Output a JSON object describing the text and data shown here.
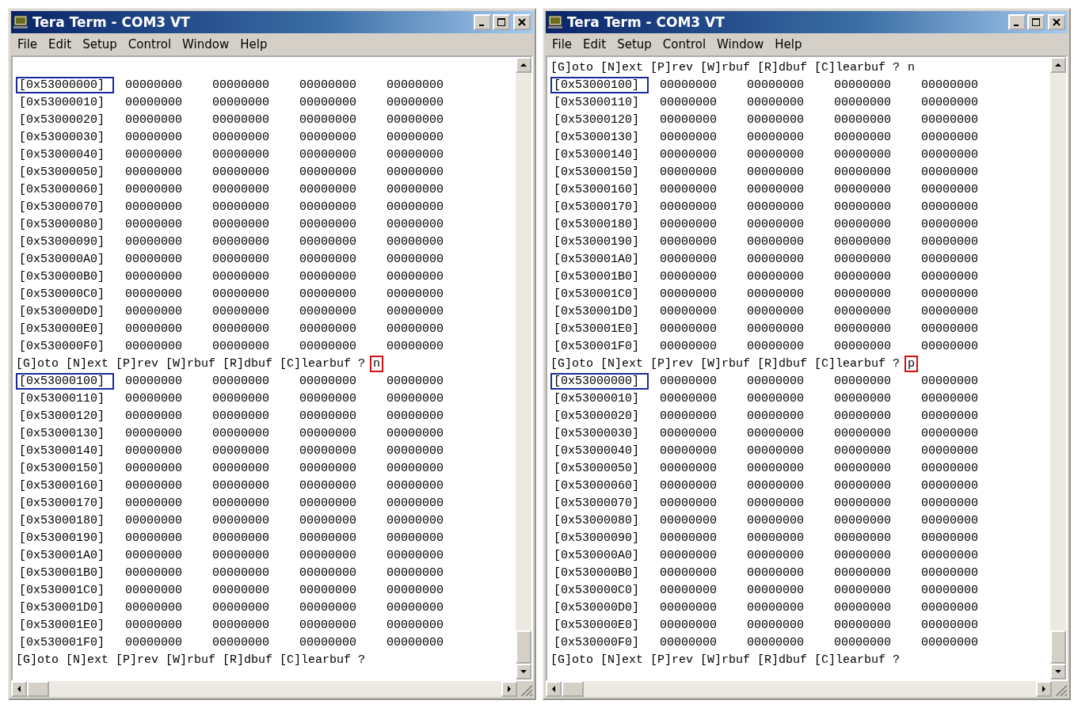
{
  "windows": [
    {
      "title": "Tera Term - COM3 VT",
      "menu": [
        "File",
        "Edit",
        "Setup",
        "Control",
        "Window",
        "Help"
      ],
      "lines": [
        {
          "kind": "blank"
        },
        {
          "kind": "row",
          "address": "[0x53000000]",
          "marked": true,
          "values": [
            "00000000",
            "00000000",
            "00000000",
            "00000000"
          ]
        },
        {
          "kind": "row",
          "address": "[0x53000010]",
          "marked": false,
          "values": [
            "00000000",
            "00000000",
            "00000000",
            "00000000"
          ]
        },
        {
          "kind": "row",
          "address": "[0x53000020]",
          "marked": false,
          "values": [
            "00000000",
            "00000000",
            "00000000",
            "00000000"
          ]
        },
        {
          "kind": "row",
          "address": "[0x53000030]",
          "marked": false,
          "values": [
            "00000000",
            "00000000",
            "00000000",
            "00000000"
          ]
        },
        {
          "kind": "row",
          "address": "[0x53000040]",
          "marked": false,
          "values": [
            "00000000",
            "00000000",
            "00000000",
            "00000000"
          ]
        },
        {
          "kind": "row",
          "address": "[0x53000050]",
          "marked": false,
          "values": [
            "00000000",
            "00000000",
            "00000000",
            "00000000"
          ]
        },
        {
          "kind": "row",
          "address": "[0x53000060]",
          "marked": false,
          "values": [
            "00000000",
            "00000000",
            "00000000",
            "00000000"
          ]
        },
        {
          "kind": "row",
          "address": "[0x53000070]",
          "marked": false,
          "values": [
            "00000000",
            "00000000",
            "00000000",
            "00000000"
          ]
        },
        {
          "kind": "row",
          "address": "[0x53000080]",
          "marked": false,
          "values": [
            "00000000",
            "00000000",
            "00000000",
            "00000000"
          ]
        },
        {
          "kind": "row",
          "address": "[0x53000090]",
          "marked": false,
          "values": [
            "00000000",
            "00000000",
            "00000000",
            "00000000"
          ]
        },
        {
          "kind": "row",
          "address": "[0x530000A0]",
          "marked": false,
          "values": [
            "00000000",
            "00000000",
            "00000000",
            "00000000"
          ]
        },
        {
          "kind": "row",
          "address": "[0x530000B0]",
          "marked": false,
          "values": [
            "00000000",
            "00000000",
            "00000000",
            "00000000"
          ]
        },
        {
          "kind": "row",
          "address": "[0x530000C0]",
          "marked": false,
          "values": [
            "00000000",
            "00000000",
            "00000000",
            "00000000"
          ]
        },
        {
          "kind": "row",
          "address": "[0x530000D0]",
          "marked": false,
          "values": [
            "00000000",
            "00000000",
            "00000000",
            "00000000"
          ]
        },
        {
          "kind": "row",
          "address": "[0x530000E0]",
          "marked": false,
          "values": [
            "00000000",
            "00000000",
            "00000000",
            "00000000"
          ]
        },
        {
          "kind": "row",
          "address": "[0x530000F0]",
          "marked": false,
          "values": [
            "00000000",
            "00000000",
            "00000000",
            "00000000"
          ]
        },
        {
          "kind": "prompt",
          "text": "[G]oto [N]ext [P]rev [W]rbuf [R]dbuf [C]learbuf ?",
          "answer": "n",
          "marked": true
        },
        {
          "kind": "row",
          "address": "[0x53000100]",
          "marked": true,
          "values": [
            "00000000",
            "00000000",
            "00000000",
            "00000000"
          ]
        },
        {
          "kind": "row",
          "address": "[0x53000110]",
          "marked": false,
          "values": [
            "00000000",
            "00000000",
            "00000000",
            "00000000"
          ]
        },
        {
          "kind": "row",
          "address": "[0x53000120]",
          "marked": false,
          "values": [
            "00000000",
            "00000000",
            "00000000",
            "00000000"
          ]
        },
        {
          "kind": "row",
          "address": "[0x53000130]",
          "marked": false,
          "values": [
            "00000000",
            "00000000",
            "00000000",
            "00000000"
          ]
        },
        {
          "kind": "row",
          "address": "[0x53000140]",
          "marked": false,
          "values": [
            "00000000",
            "00000000",
            "00000000",
            "00000000"
          ]
        },
        {
          "kind": "row",
          "address": "[0x53000150]",
          "marked": false,
          "values": [
            "00000000",
            "00000000",
            "00000000",
            "00000000"
          ]
        },
        {
          "kind": "row",
          "address": "[0x53000160]",
          "marked": false,
          "values": [
            "00000000",
            "00000000",
            "00000000",
            "00000000"
          ]
        },
        {
          "kind": "row",
          "address": "[0x53000170]",
          "marked": false,
          "values": [
            "00000000",
            "00000000",
            "00000000",
            "00000000"
          ]
        },
        {
          "kind": "row",
          "address": "[0x53000180]",
          "marked": false,
          "values": [
            "00000000",
            "00000000",
            "00000000",
            "00000000"
          ]
        },
        {
          "kind": "row",
          "address": "[0x53000190]",
          "marked": false,
          "values": [
            "00000000",
            "00000000",
            "00000000",
            "00000000"
          ]
        },
        {
          "kind": "row",
          "address": "[0x530001A0]",
          "marked": false,
          "values": [
            "00000000",
            "00000000",
            "00000000",
            "00000000"
          ]
        },
        {
          "kind": "row",
          "address": "[0x530001B0]",
          "marked": false,
          "values": [
            "00000000",
            "00000000",
            "00000000",
            "00000000"
          ]
        },
        {
          "kind": "row",
          "address": "[0x530001C0]",
          "marked": false,
          "values": [
            "00000000",
            "00000000",
            "00000000",
            "00000000"
          ]
        },
        {
          "kind": "row",
          "address": "[0x530001D0]",
          "marked": false,
          "values": [
            "00000000",
            "00000000",
            "00000000",
            "00000000"
          ]
        },
        {
          "kind": "row",
          "address": "[0x530001E0]",
          "marked": false,
          "values": [
            "00000000",
            "00000000",
            "00000000",
            "00000000"
          ]
        },
        {
          "kind": "row",
          "address": "[0x530001F0]",
          "marked": false,
          "values": [
            "00000000",
            "00000000",
            "00000000",
            "00000000"
          ]
        },
        {
          "kind": "prompt",
          "text": "[G]oto [N]ext [P]rev [W]rbuf [R]dbuf [C]learbuf ?"
        }
      ]
    },
    {
      "title": "Tera Term - COM3 VT",
      "menu": [
        "File",
        "Edit",
        "Setup",
        "Control",
        "Window",
        "Help"
      ],
      "lines": [
        {
          "kind": "prompt",
          "text": "[G]oto [N]ext [P]rev [W]rbuf [R]dbuf [C]learbuf ?",
          "answer": "n",
          "marked": false
        },
        {
          "kind": "row",
          "address": "[0x53000100]",
          "marked": true,
          "values": [
            "00000000",
            "00000000",
            "00000000",
            "00000000"
          ]
        },
        {
          "kind": "row",
          "address": "[0x53000110]",
          "marked": false,
          "values": [
            "00000000",
            "00000000",
            "00000000",
            "00000000"
          ]
        },
        {
          "kind": "row",
          "address": "[0x53000120]",
          "marked": false,
          "values": [
            "00000000",
            "00000000",
            "00000000",
            "00000000"
          ]
        },
        {
          "kind": "row",
          "address": "[0x53000130]",
          "marked": false,
          "values": [
            "00000000",
            "00000000",
            "00000000",
            "00000000"
          ]
        },
        {
          "kind": "row",
          "address": "[0x53000140]",
          "marked": false,
          "values": [
            "00000000",
            "00000000",
            "00000000",
            "00000000"
          ]
        },
        {
          "kind": "row",
          "address": "[0x53000150]",
          "marked": false,
          "values": [
            "00000000",
            "00000000",
            "00000000",
            "00000000"
          ]
        },
        {
          "kind": "row",
          "address": "[0x53000160]",
          "marked": false,
          "values": [
            "00000000",
            "00000000",
            "00000000",
            "00000000"
          ]
        },
        {
          "kind": "row",
          "address": "[0x53000170]",
          "marked": false,
          "values": [
            "00000000",
            "00000000",
            "00000000",
            "00000000"
          ]
        },
        {
          "kind": "row",
          "address": "[0x53000180]",
          "marked": false,
          "values": [
            "00000000",
            "00000000",
            "00000000",
            "00000000"
          ]
        },
        {
          "kind": "row",
          "address": "[0x53000190]",
          "marked": false,
          "values": [
            "00000000",
            "00000000",
            "00000000",
            "00000000"
          ]
        },
        {
          "kind": "row",
          "address": "[0x530001A0]",
          "marked": false,
          "values": [
            "00000000",
            "00000000",
            "00000000",
            "00000000"
          ]
        },
        {
          "kind": "row",
          "address": "[0x530001B0]",
          "marked": false,
          "values": [
            "00000000",
            "00000000",
            "00000000",
            "00000000"
          ]
        },
        {
          "kind": "row",
          "address": "[0x530001C0]",
          "marked": false,
          "values": [
            "00000000",
            "00000000",
            "00000000",
            "00000000"
          ]
        },
        {
          "kind": "row",
          "address": "[0x530001D0]",
          "marked": false,
          "values": [
            "00000000",
            "00000000",
            "00000000",
            "00000000"
          ]
        },
        {
          "kind": "row",
          "address": "[0x530001E0]",
          "marked": false,
          "values": [
            "00000000",
            "00000000",
            "00000000",
            "00000000"
          ]
        },
        {
          "kind": "row",
          "address": "[0x530001F0]",
          "marked": false,
          "values": [
            "00000000",
            "00000000",
            "00000000",
            "00000000"
          ]
        },
        {
          "kind": "prompt",
          "text": "[G]oto [N]ext [P]rev [W]rbuf [R]dbuf [C]learbuf ?",
          "answer": "p",
          "marked": true
        },
        {
          "kind": "row",
          "address": "[0x53000000]",
          "marked": true,
          "values": [
            "00000000",
            "00000000",
            "00000000",
            "00000000"
          ]
        },
        {
          "kind": "row",
          "address": "[0x53000010]",
          "marked": false,
          "values": [
            "00000000",
            "00000000",
            "00000000",
            "00000000"
          ]
        },
        {
          "kind": "row",
          "address": "[0x53000020]",
          "marked": false,
          "values": [
            "00000000",
            "00000000",
            "00000000",
            "00000000"
          ]
        },
        {
          "kind": "row",
          "address": "[0x53000030]",
          "marked": false,
          "values": [
            "00000000",
            "00000000",
            "00000000",
            "00000000"
          ]
        },
        {
          "kind": "row",
          "address": "[0x53000040]",
          "marked": false,
          "values": [
            "00000000",
            "00000000",
            "00000000",
            "00000000"
          ]
        },
        {
          "kind": "row",
          "address": "[0x53000050]",
          "marked": false,
          "values": [
            "00000000",
            "00000000",
            "00000000",
            "00000000"
          ]
        },
        {
          "kind": "row",
          "address": "[0x53000060]",
          "marked": false,
          "values": [
            "00000000",
            "00000000",
            "00000000",
            "00000000"
          ]
        },
        {
          "kind": "row",
          "address": "[0x53000070]",
          "marked": false,
          "values": [
            "00000000",
            "00000000",
            "00000000",
            "00000000"
          ]
        },
        {
          "kind": "row",
          "address": "[0x53000080]",
          "marked": false,
          "values": [
            "00000000",
            "00000000",
            "00000000",
            "00000000"
          ]
        },
        {
          "kind": "row",
          "address": "[0x53000090]",
          "marked": false,
          "values": [
            "00000000",
            "00000000",
            "00000000",
            "00000000"
          ]
        },
        {
          "kind": "row",
          "address": "[0x530000A0]",
          "marked": false,
          "values": [
            "00000000",
            "00000000",
            "00000000",
            "00000000"
          ]
        },
        {
          "kind": "row",
          "address": "[0x530000B0]",
          "marked": false,
          "values": [
            "00000000",
            "00000000",
            "00000000",
            "00000000"
          ]
        },
        {
          "kind": "row",
          "address": "[0x530000C0]",
          "marked": false,
          "values": [
            "00000000",
            "00000000",
            "00000000",
            "00000000"
          ]
        },
        {
          "kind": "row",
          "address": "[0x530000D0]",
          "marked": false,
          "values": [
            "00000000",
            "00000000",
            "00000000",
            "00000000"
          ]
        },
        {
          "kind": "row",
          "address": "[0x530000E0]",
          "marked": false,
          "values": [
            "00000000",
            "00000000",
            "00000000",
            "00000000"
          ]
        },
        {
          "kind": "row",
          "address": "[0x530000F0]",
          "marked": false,
          "values": [
            "00000000",
            "00000000",
            "00000000",
            "00000000"
          ]
        },
        {
          "kind": "prompt",
          "text": "[G]oto [N]ext [P]rev [W]rbuf [R]dbuf [C]learbuf ?"
        }
      ]
    }
  ]
}
